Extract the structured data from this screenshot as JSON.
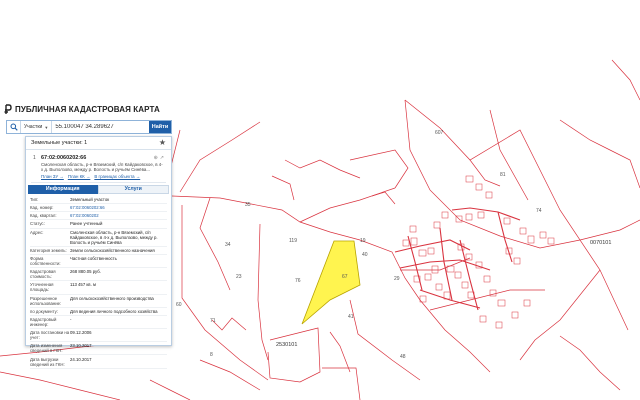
{
  "app": {
    "title": "ПУБЛИЧНАЯ КАДАСТРОВАЯ КАРТА"
  },
  "search": {
    "type_label": "Участки",
    "value": "55.100047 34.289627",
    "button_label": "Найти"
  },
  "panel": {
    "header": "Земельные участки: 1",
    "result": {
      "index": "1",
      "number": "67:02:0060202:66",
      "address": "Смоленская область, р-н Вяземский, с/п Кайдаковское, в 4-х д. Выползово, между р. Волость и ручьём Синёва...",
      "links": [
        "План ЗУ →",
        "План КК →",
        "В границах объекта →"
      ],
      "tools": [
        "⊕",
        "↗"
      ]
    },
    "tabs": {
      "info": "Информация",
      "services": "Услуги"
    },
    "rows": [
      {
        "label": "Тип:",
        "value": "Земельный участок",
        "link": false
      },
      {
        "label": "Кад. номер:",
        "value": "67:02:0060202:66",
        "link": true
      },
      {
        "label": "Кад. квартал:",
        "value": "67:02:0060202",
        "link": true
      },
      {
        "label": "Статус:",
        "value": "Ранее учтенный",
        "link": false
      },
      {
        "label": "Адрес:",
        "value": "Смоленская область, р-н Вяземский, с/п Кайдаковское, в 4-х д. Выползово, между р. Волость и ручьём Синёва",
        "link": false
      },
      {
        "label": "Категория земель:",
        "value": "Земли сельскохозяйственного назначения",
        "link": false
      },
      {
        "label": "Форма собственности:",
        "value": "Частная собственность",
        "link": false
      },
      {
        "label": "Кадастровая стоимость:",
        "value": "268 880.05 руб.",
        "link": false
      },
      {
        "label": "Уточненная площадь:",
        "value": "113 457 кв. м",
        "link": false
      },
      {
        "label": "Разрешенное использование:",
        "value": "Для сельскохозяйственного производства",
        "link": false
      },
      {
        "label": "по документу:",
        "value": "Для ведения личного подсобного хозяйства",
        "link": false
      },
      {
        "label": "Кадастровый инженер:",
        "value": "-",
        "link": false
      },
      {
        "label": "Дата постановки на учет:",
        "value": "09.12.2006",
        "link": false
      },
      {
        "label": "Дата изменения сведений в ГКН:",
        "value": "23.10.2017",
        "link": false
      },
      {
        "label": "Дата выгрузки сведений из ГКН:",
        "value": "24.10.2017",
        "link": false
      }
    ]
  },
  "map": {
    "labels": [
      "67",
      "40",
      "76",
      "119",
      "2530101",
      "0070101",
      "29",
      "19",
      "41",
      "48",
      "23",
      "8",
      "607",
      "81",
      "74",
      "34",
      "35",
      "71",
      "60"
    ],
    "colors": {
      "boundary": "#d9333f",
      "highlight": "#fff44f",
      "highlight_stroke": "#b8a300"
    }
  }
}
